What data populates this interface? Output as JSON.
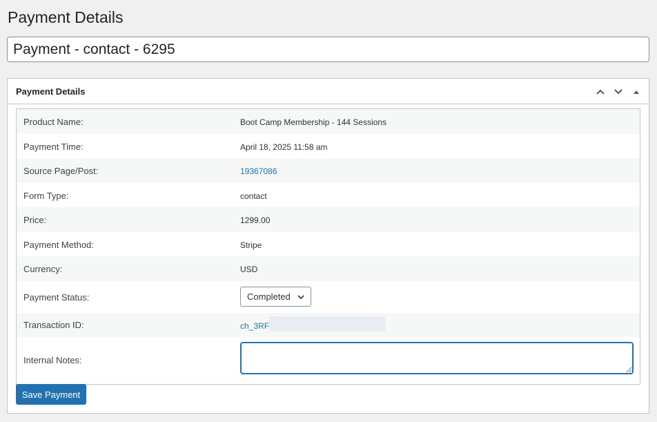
{
  "page": {
    "title": "Payment Details"
  },
  "title_field": {
    "value": "Payment - contact - 6295"
  },
  "metabox": {
    "title": "Payment Details",
    "controls": {
      "move_up_icon": "chevron-up-icon",
      "move_down_icon": "chevron-down-icon",
      "toggle_icon": "triangle-up-icon"
    }
  },
  "details": {
    "product_name": {
      "label": "Product Name:",
      "value": "Boot Camp Membership - 144 Sessions"
    },
    "payment_time": {
      "label": "Payment Time:",
      "value": "April 18, 2025 11:58 am"
    },
    "source_page": {
      "label": "Source Page/Post:",
      "value": "19367086"
    },
    "form_type": {
      "label": "Form Type:",
      "value": "contact"
    },
    "price": {
      "label": "Price:",
      "value": "1299.00"
    },
    "payment_method": {
      "label": "Payment Method:",
      "value": "Stripe"
    },
    "currency": {
      "label": "Currency:",
      "value": "USD"
    },
    "payment_status": {
      "label": "Payment Status:",
      "selected": "Completed"
    },
    "transaction_id": {
      "label": "Transaction ID:",
      "value": "ch_3RFI"
    },
    "internal_notes": {
      "label": "Internal Notes:",
      "value": ""
    }
  },
  "save_button": {
    "label": "Save Payment"
  },
  "colors": {
    "accent": "#2271b1",
    "background": "#f0f0f1",
    "row_alt": "#f6f7f7",
    "border": "#c3c4c7"
  }
}
